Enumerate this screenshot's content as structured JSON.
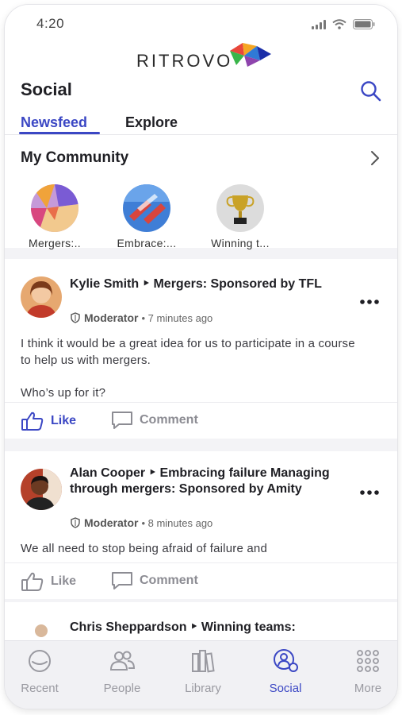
{
  "status_bar": {
    "time": "4:20"
  },
  "brand": {
    "name": "RITROVO"
  },
  "header": {
    "title": "Social"
  },
  "tabs": [
    {
      "label": "Newsfeed",
      "active": true
    },
    {
      "label": "Explore",
      "active": false
    }
  ],
  "community": {
    "title": "My Community",
    "items": [
      {
        "label": "Mergers:.."
      },
      {
        "label": "Embrace:..."
      },
      {
        "label": "Winning t..."
      }
    ]
  },
  "posts": [
    {
      "author_line": "Kylie Smith ‣ Mergers: Sponsored by TFL",
      "role": "Moderator",
      "time": "• 7 minutes ago",
      "body": "I think it would be a great idea for us to participate in a course to help us with mergers.",
      "body2": "Who’s up for it?",
      "like_label": "Like",
      "comment_label": "Comment",
      "liked": true
    },
    {
      "author_line": "Alan Cooper ‣ Embracing failure Managing through mergers: Sponsored by Amity",
      "role": "Moderator",
      "time": "• 8 minutes ago",
      "body": "We all need to stop being afraid of failure and",
      "like_label": "Like",
      "comment_label": "Comment",
      "liked": false
    },
    {
      "author_line": "Chris Sheppardson ‣ Winning teams:"
    }
  ],
  "tabbar": [
    {
      "label": "Recent",
      "icon": "clock-icon"
    },
    {
      "label": "People",
      "icon": "people-icon"
    },
    {
      "label": "Library",
      "icon": "library-icon"
    },
    {
      "label": "Social",
      "icon": "social-icon",
      "active": true
    },
    {
      "label": "More",
      "icon": "grid-icon"
    }
  ],
  "colors": {
    "accent": "#3b47c4",
    "muted": "#8c8c93"
  }
}
